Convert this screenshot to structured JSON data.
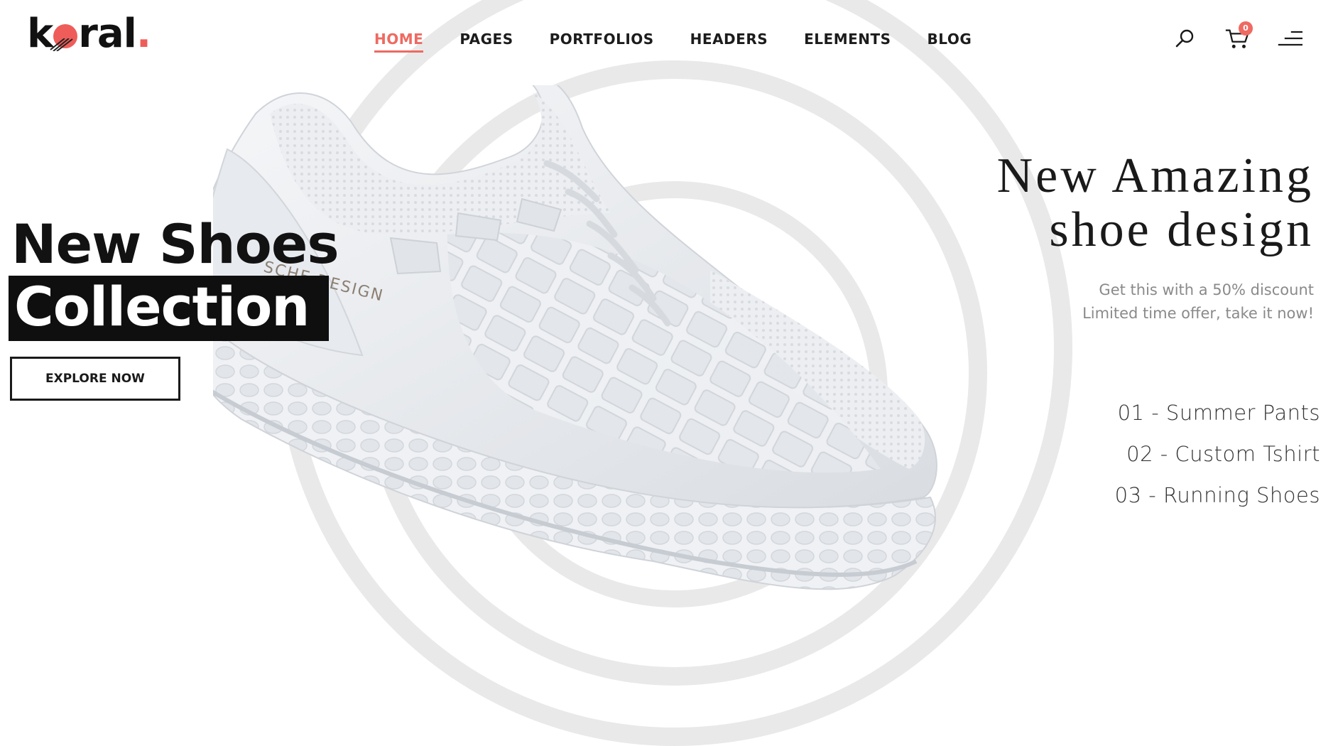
{
  "brand": {
    "logo_text_prefix": "k",
    "logo_text_suffix": "ral",
    "logo_dot": ".",
    "accent_color": "#ee6a62"
  },
  "nav": {
    "items": [
      {
        "label": "HOME",
        "active": true
      },
      {
        "label": "PAGES"
      },
      {
        "label": "PORTFOLIOS"
      },
      {
        "label": "HEADERS"
      },
      {
        "label": "ELEMENTS"
      },
      {
        "label": "BLOG"
      }
    ]
  },
  "header_icons": {
    "search": "search-icon",
    "cart": "cart-icon",
    "menu": "hamburger-menu-icon",
    "cart_count": "0"
  },
  "hero": {
    "title_line1": "New Shoes",
    "title_line2": "Collection",
    "cta_label": "EXPLORE NOW",
    "shoe_brand_print": "SCHE DESIGN"
  },
  "promo": {
    "title_line1": "New Amazing",
    "title_line2": "shoe design",
    "subtitle_line1": "Get this with a 50% discount",
    "subtitle_line2": "Limited time offer, take it now!"
  },
  "collections": [
    "01 - Summer Pants",
    "02 - Custom Tshirt",
    "03 - Running Shoes"
  ]
}
